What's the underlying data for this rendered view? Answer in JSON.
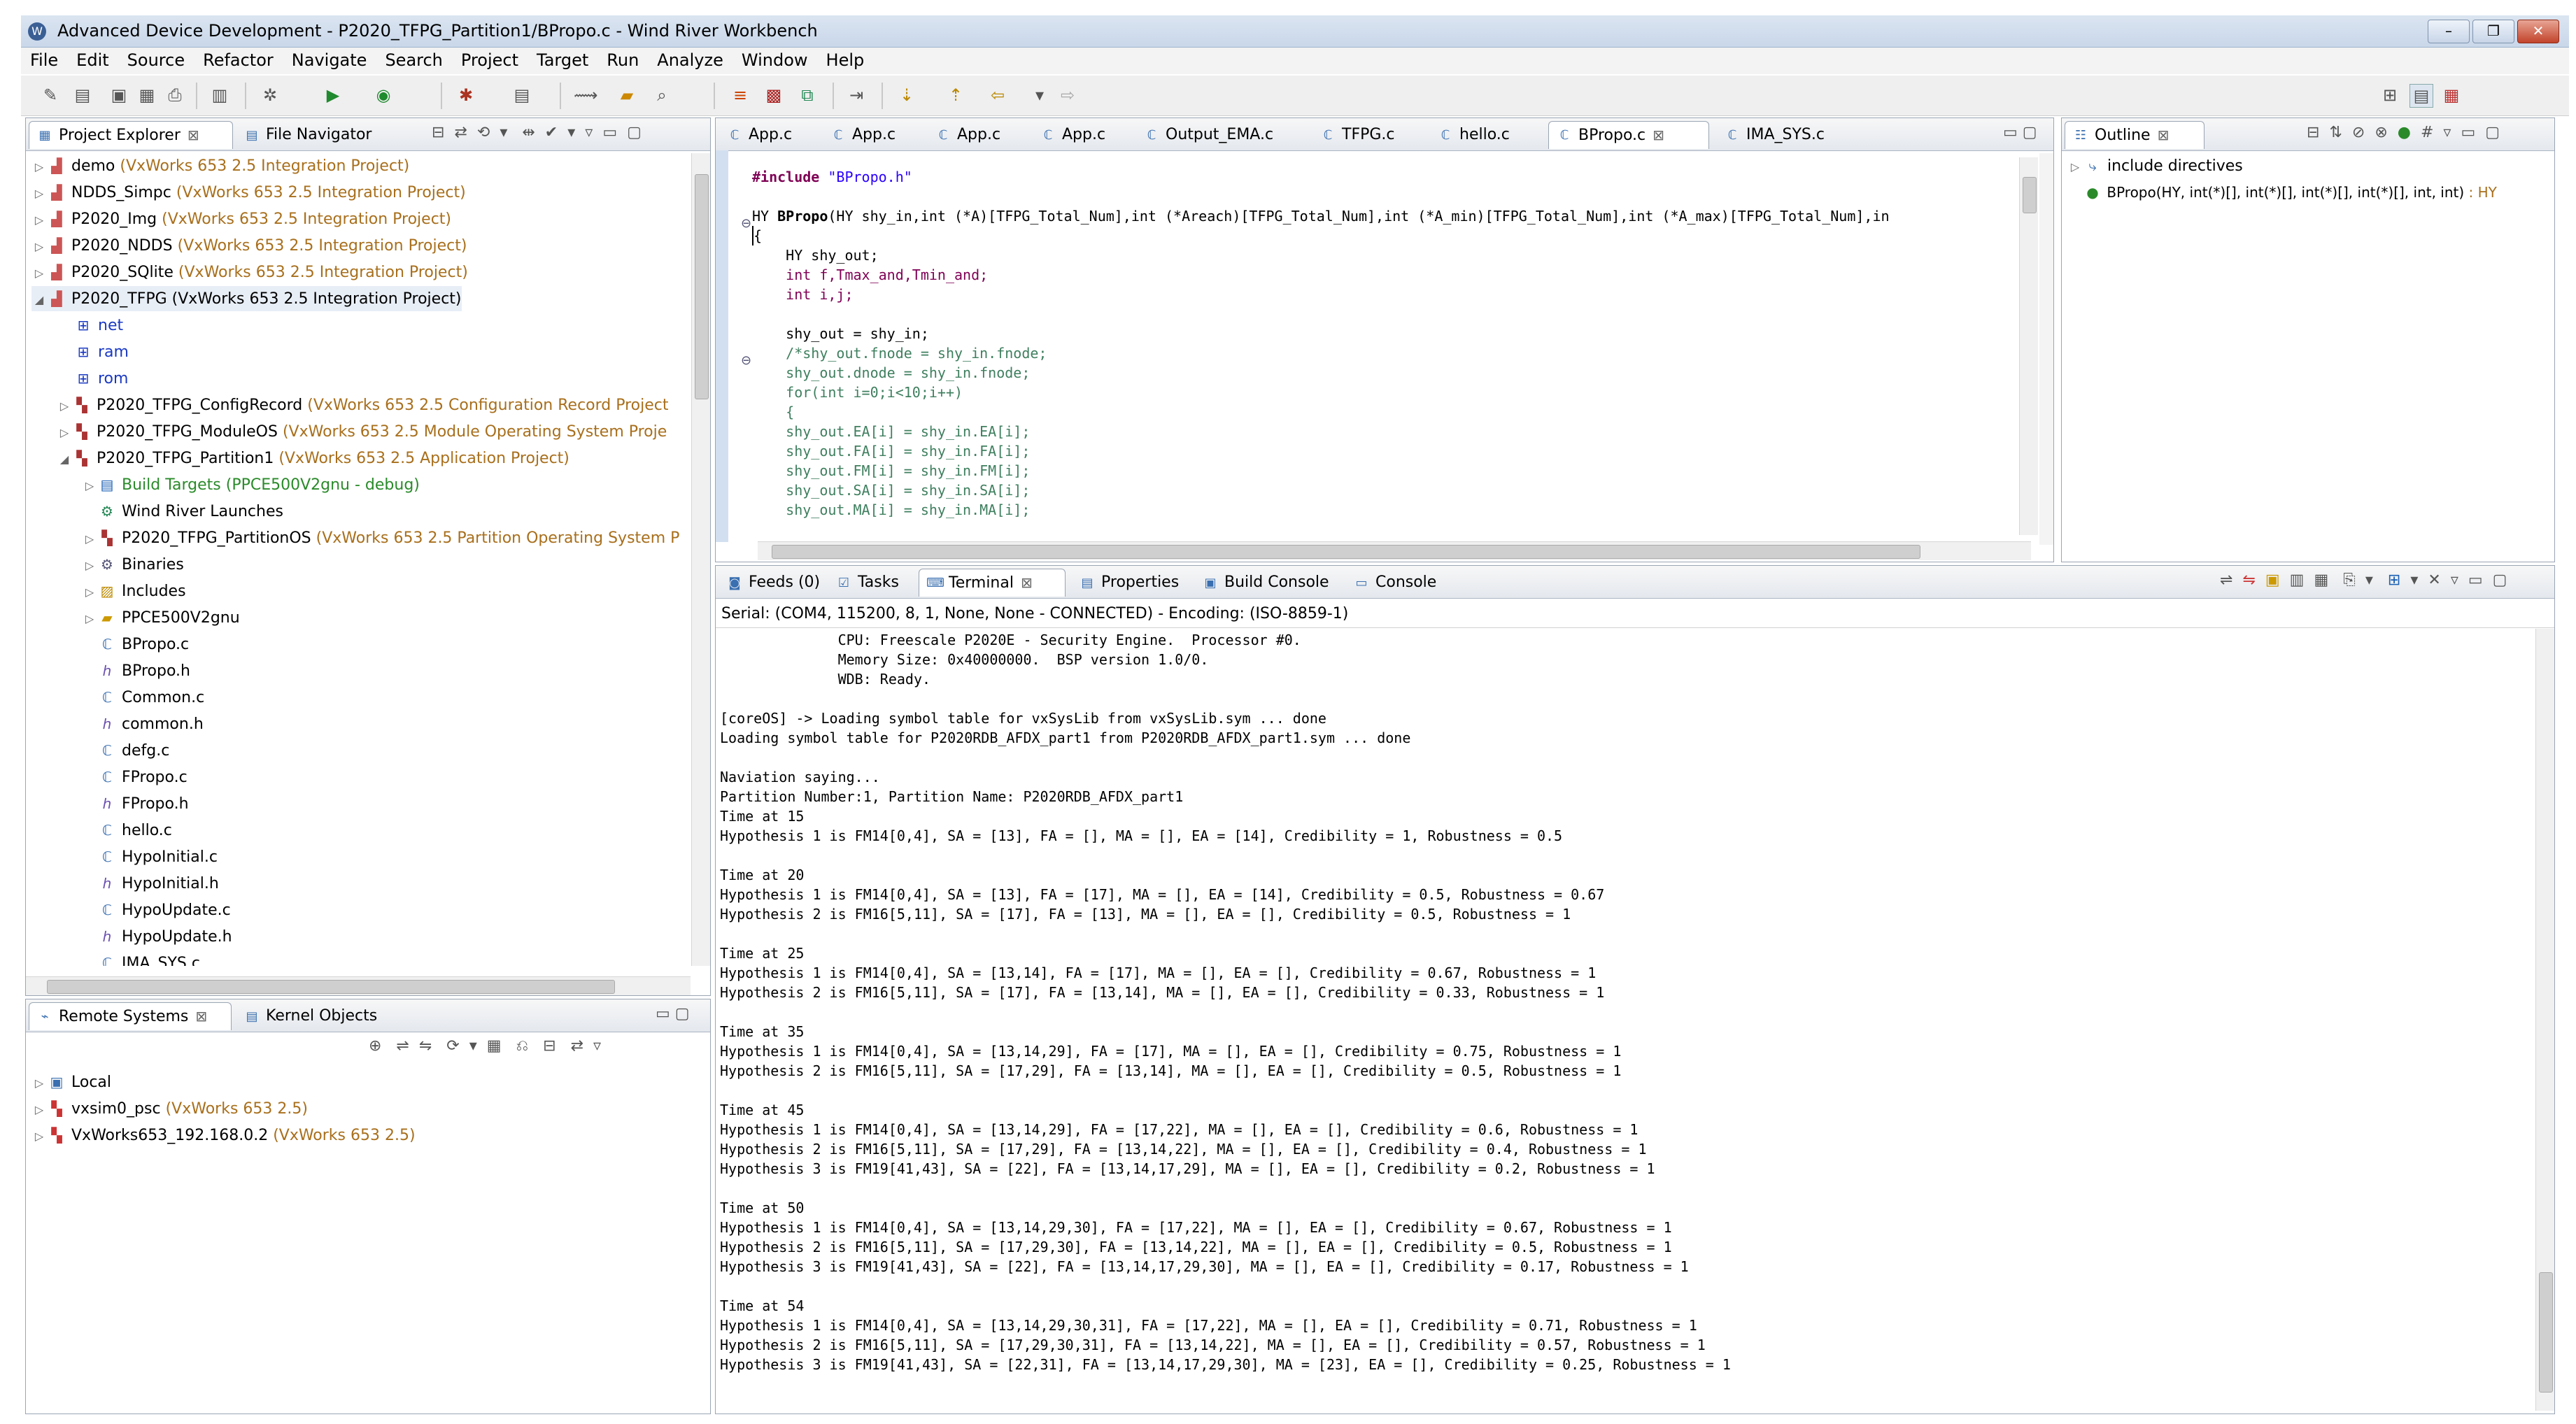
{
  "window": {
    "title": "Advanced Device Development - P2020_TFPG_Partition1/BPropo.c - Wind River Workbench",
    "minimize": "–",
    "restore": "❐",
    "close": "✕"
  },
  "menu": [
    "File",
    "Edit",
    "Source",
    "Refactor",
    "Navigate",
    "Search",
    "Project",
    "Target",
    "Run",
    "Analyze",
    "Window",
    "Help"
  ],
  "project_explorer": {
    "tabs": [
      {
        "label": "Project Explorer",
        "icon": "folder-tree-icon"
      },
      {
        "label": "File Navigator",
        "icon": "file-navigator-icon"
      }
    ],
    "items": [
      {
        "label": "demo",
        "dec": "(VxWorks 653 2.5 Integration Project)"
      },
      {
        "label": "NDDS_Simpc",
        "dec": "(VxWorks 653 2.5 Integration Project)"
      },
      {
        "label": "P2020_Img",
        "dec": "(VxWorks 653 2.5 Integration Project)"
      },
      {
        "label": "P2020_NDDS",
        "dec": "(VxWorks 653 2.5 Integration Project)"
      },
      {
        "label": "P2020_SQlite",
        "dec": "(VxWorks 653 2.5 Integration Project)"
      },
      {
        "label": "P2020_TFPG (VxWorks 653 2.5 Integration Project)",
        "dec": ""
      },
      {
        "label": "net",
        "dec": ""
      },
      {
        "label": "ram",
        "dec": ""
      },
      {
        "label": "rom",
        "dec": ""
      },
      {
        "label": "P2020_TFPG_ConfigRecord",
        "dec": "(VxWorks 653 2.5 Configuration Record Project"
      },
      {
        "label": "P2020_TFPG_ModuleOS",
        "dec": "(VxWorks 653 2.5 Module Operating System Proje"
      },
      {
        "label": "P2020_TFPG_Partition1",
        "dec": "(VxWorks 653 2.5 Application Project)"
      },
      {
        "label": "Build Targets (PPCE500V2gnu - debug)",
        "dec": ""
      },
      {
        "label": "Wind River Launches",
        "dec": ""
      },
      {
        "label": "P2020_TFPG_PartitionOS",
        "dec": "(VxWorks 653 2.5 Partition Operating System P"
      },
      {
        "label": "Binaries",
        "dec": ""
      },
      {
        "label": "Includes",
        "dec": ""
      },
      {
        "label": "PPCE500V2gnu",
        "dec": ""
      },
      {
        "label": "BPropo.c",
        "dec": ""
      },
      {
        "label": "BPropo.h",
        "dec": ""
      },
      {
        "label": "Common.c",
        "dec": ""
      },
      {
        "label": "common.h",
        "dec": ""
      },
      {
        "label": "defg.c",
        "dec": ""
      },
      {
        "label": "FPropo.c",
        "dec": ""
      },
      {
        "label": "FPropo.h",
        "dec": ""
      },
      {
        "label": "hello.c",
        "dec": ""
      },
      {
        "label": "HypoInitial.c",
        "dec": ""
      },
      {
        "label": "HypoInitial.h",
        "dec": ""
      },
      {
        "label": "HypoUpdate.c",
        "dec": ""
      },
      {
        "label": "HypoUpdate.h",
        "dec": ""
      },
      {
        "label": "IMA_SYS.c",
        "dec": ""
      }
    ]
  },
  "remote_systems": {
    "tabs": [
      {
        "label": "Remote Systems",
        "icon": "remote-systems-icon"
      },
      {
        "label": "Kernel Objects",
        "icon": "kernel-objects-icon"
      }
    ],
    "items": [
      {
        "label": "Local",
        "dec": ""
      },
      {
        "label": "vxsim0_psc",
        "dec": "(VxWorks 653 2.5)"
      },
      {
        "label": "VxWorks653_192.168.0.2",
        "dec": "(VxWorks 653 2.5)"
      }
    ]
  },
  "editor": {
    "tabs": [
      "App.c",
      "App.c",
      "App.c",
      "App.c",
      "Output_EMA.c",
      "TFPG.c",
      "hello.c",
      "BPropo.c",
      "IMA_SYS.c"
    ],
    "active_tab": "BPropo.c",
    "lines": {
      "l1_pre": "#include ",
      "l1_str": "\"BPropo.h\"",
      "l2_type": "HY ",
      "l2_fn": "BPropo",
      "l2_rest": "(HY shy_in,int (*A)[TFPG_Total_Num],int (*Areach)[TFPG_Total_Num],int (*A_min)[TFPG_Total_Num],int (*A_max)[TFPG_Total_Num],in",
      "l3": "{",
      "l4": "    HY shy_out;",
      "l5": "    int f,Tmax_and,Tmin_and;",
      "l6": "    int i,j;",
      "l7": "    shy_out = shy_in;",
      "l8": "    /*shy_out.fnode = shy_in.fnode;",
      "l9": "    shy_out.dnode = shy_in.fnode;",
      "l10": "    for(int i=0;i<10;i++)",
      "l11": "    {",
      "l12": "    shy_out.EA[i] = shy_in.EA[i];",
      "l13": "    shy_out.FA[i] = shy_in.FA[i];",
      "l14": "    shy_out.FM[i] = shy_in.FM[i];",
      "l15": "    shy_out.SA[i] = shy_in.SA[i];",
      "l16": "    shy_out.MA[i] = shy_in.MA[i];"
    }
  },
  "outline": {
    "tab": "Outline",
    "items": [
      {
        "label": "include directives",
        "dec": ""
      },
      {
        "label": "BPropo(HY, int(*)[], int(*)[], int(*)[], int(*)[], int, int)",
        "dec": ": HY"
      }
    ]
  },
  "console": {
    "tabs": [
      "Feeds (0)",
      "Tasks",
      "Terminal",
      "Properties",
      "Build Console",
      "Console"
    ],
    "active_tab": "Terminal",
    "status": "Serial: (COM4, 115200, 8, 1, None, None - CONNECTED) - Encoding: (ISO-8859-1)",
    "lines": [
      "              CPU: Freescale P2020E - Security Engine.  Processor #0.",
      "              Memory Size: 0x40000000.  BSP version 1.0/0.",
      "              WDB: Ready.",
      "",
      "[coreOS] -> Loading symbol table for vxSysLib from vxSysLib.sym ... done",
      "Loading symbol table for P2020RDB_AFDX_part1 from P2020RDB_AFDX_part1.sym ... done",
      "",
      "Naviation saying...",
      "Partition Number:1, Partition Name: P2020RDB_AFDX_part1",
      "Time at 15",
      "Hypothesis 1 is FM14[0,4], SA = [13], FA = [], MA = [], EA = [14], Credibility = 1, Robustness = 0.5",
      "",
      "Time at 20",
      "Hypothesis 1 is FM14[0,4], SA = [13], FA = [17], MA = [], EA = [14], Credibility = 0.5, Robustness = 0.67",
      "Hypothesis 2 is FM16[5,11], SA = [17], FA = [13], MA = [], EA = [], Credibility = 0.5, Robustness = 1",
      "",
      "Time at 25",
      "Hypothesis 1 is FM14[0,4], SA = [13,14], FA = [17], MA = [], EA = [], Credibility = 0.67, Robustness = 1",
      "Hypothesis 2 is FM16[5,11], SA = [17], FA = [13,14], MA = [], EA = [], Credibility = 0.33, Robustness = 1",
      "",
      "Time at 35",
      "Hypothesis 1 is FM14[0,4], SA = [13,14,29], FA = [17], MA = [], EA = [], Credibility = 0.75, Robustness = 1",
      "Hypothesis 2 is FM16[5,11], SA = [17,29], FA = [13,14], MA = [], EA = [], Credibility = 0.5, Robustness = 1",
      "",
      "Time at 45",
      "Hypothesis 1 is FM14[0,4], SA = [13,14,29], FA = [17,22], MA = [], EA = [], Credibility = 0.6, Robustness = 1",
      "Hypothesis 2 is FM16[5,11], SA = [17,29], FA = [13,14,22], MA = [], EA = [], Credibility = 0.4, Robustness = 1",
      "Hypothesis 3 is FM19[41,43], SA = [22], FA = [13,14,17,29], MA = [], EA = [], Credibility = 0.2, Robustness = 1",
      "",
      "Time at 50",
      "Hypothesis 1 is FM14[0,4], SA = [13,14,29,30], FA = [17,22], MA = [], EA = [], Credibility = 0.67, Robustness = 1",
      "Hypothesis 2 is FM16[5,11], SA = [17,29,30], FA = [13,14,22], MA = [], EA = [], Credibility = 0.5, Robustness = 1",
      "Hypothesis 3 is FM19[41,43], SA = [22], FA = [13,14,17,29,30], MA = [], EA = [], Credibility = 0.17, Robustness = 1",
      "",
      "Time at 54",
      "Hypothesis 1 is FM14[0,4], SA = [13,14,29,30,31], FA = [17,22], MA = [], EA = [], Credibility = 0.71, Robustness = 1",
      "Hypothesis 2 is FM16[5,11], SA = [17,29,30,31], FA = [13,14,22], MA = [], EA = [], Credibility = 0.57, Robustness = 1",
      "Hypothesis 3 is FM19[41,43], SA = [22,31], FA = [13,14,17,29,30], MA = [23], EA = [], Credibility = 0.25, Robustness = 1"
    ]
  },
  "colors": {
    "decoration": "#a86f1c",
    "keyword": "#7f0055",
    "string": "#2a00ff",
    "comment": "#3f7f5f"
  }
}
